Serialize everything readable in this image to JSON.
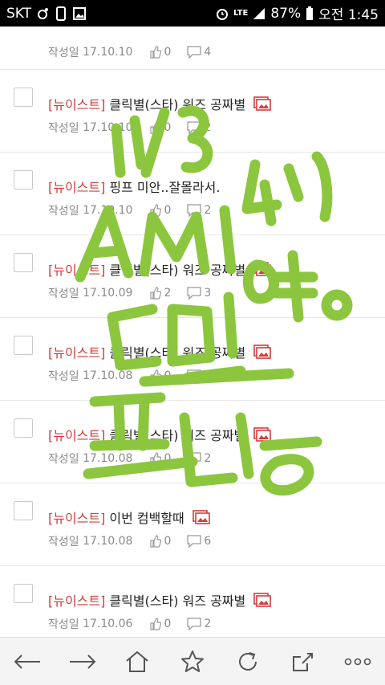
{
  "status_bar": {
    "carrier": "SKT",
    "network": "LTE",
    "battery": "87%",
    "time": "오전 1:45"
  },
  "posts": [
    {
      "tag": "",
      "title": "",
      "date_label": "작성일",
      "date": "17.10.10",
      "likes": "0",
      "comments": "4",
      "has_image": false
    },
    {
      "tag": "[뉴이스트]",
      "title": "클릭별(스타) 워즈 공짜별",
      "date_label": "작성일",
      "date": "17.10.10",
      "likes": "0",
      "comments": "2",
      "has_image": true
    },
    {
      "tag": "[뉴이스트]",
      "title": "핑프 미안..잘몰라서.",
      "date_label": "작성일",
      "date": "17.10.10",
      "likes": "0",
      "comments": "2",
      "has_image": false
    },
    {
      "tag": "[뉴이스트]",
      "title": "클릭별(스타) 워즈 공짜별",
      "date_label": "작성일",
      "date": "17.10.09",
      "likes": "2",
      "comments": "3",
      "has_image": true
    },
    {
      "tag": "[뉴이스트]",
      "title": "클릭별(스타) 워즈 공짜별",
      "date_label": "작성일",
      "date": "17.10.08",
      "likes": "0",
      "comments": "3",
      "has_image": true
    },
    {
      "tag": "[뉴이스트]",
      "title": "클릭별(스타) 워즈 공짜별",
      "date_label": "작성일",
      "date": "17.10.08",
      "likes": "0",
      "comments": "2",
      "has_image": true
    },
    {
      "tag": "[뉴이스트]",
      "title": "이번 컴백할때",
      "date_label": "작성일",
      "date": "17.10.08",
      "likes": "0",
      "comments": "6",
      "has_image": true
    },
    {
      "tag": "[뉴이스트]",
      "title": "클릭별(스타) 워즈 공짜별",
      "date_label": "작성일",
      "date": "17.10.06",
      "likes": "0",
      "comments": "2",
      "has_image": true
    }
  ],
  "toolbar": {
    "items": [
      "back-icon",
      "forward-icon",
      "home-icon",
      "bookmark-star-icon",
      "refresh-icon",
      "share-icon",
      "more-icon"
    ]
  },
  "colors": {
    "tag": "#d63b3b",
    "scribble": "#8cc63f"
  }
}
